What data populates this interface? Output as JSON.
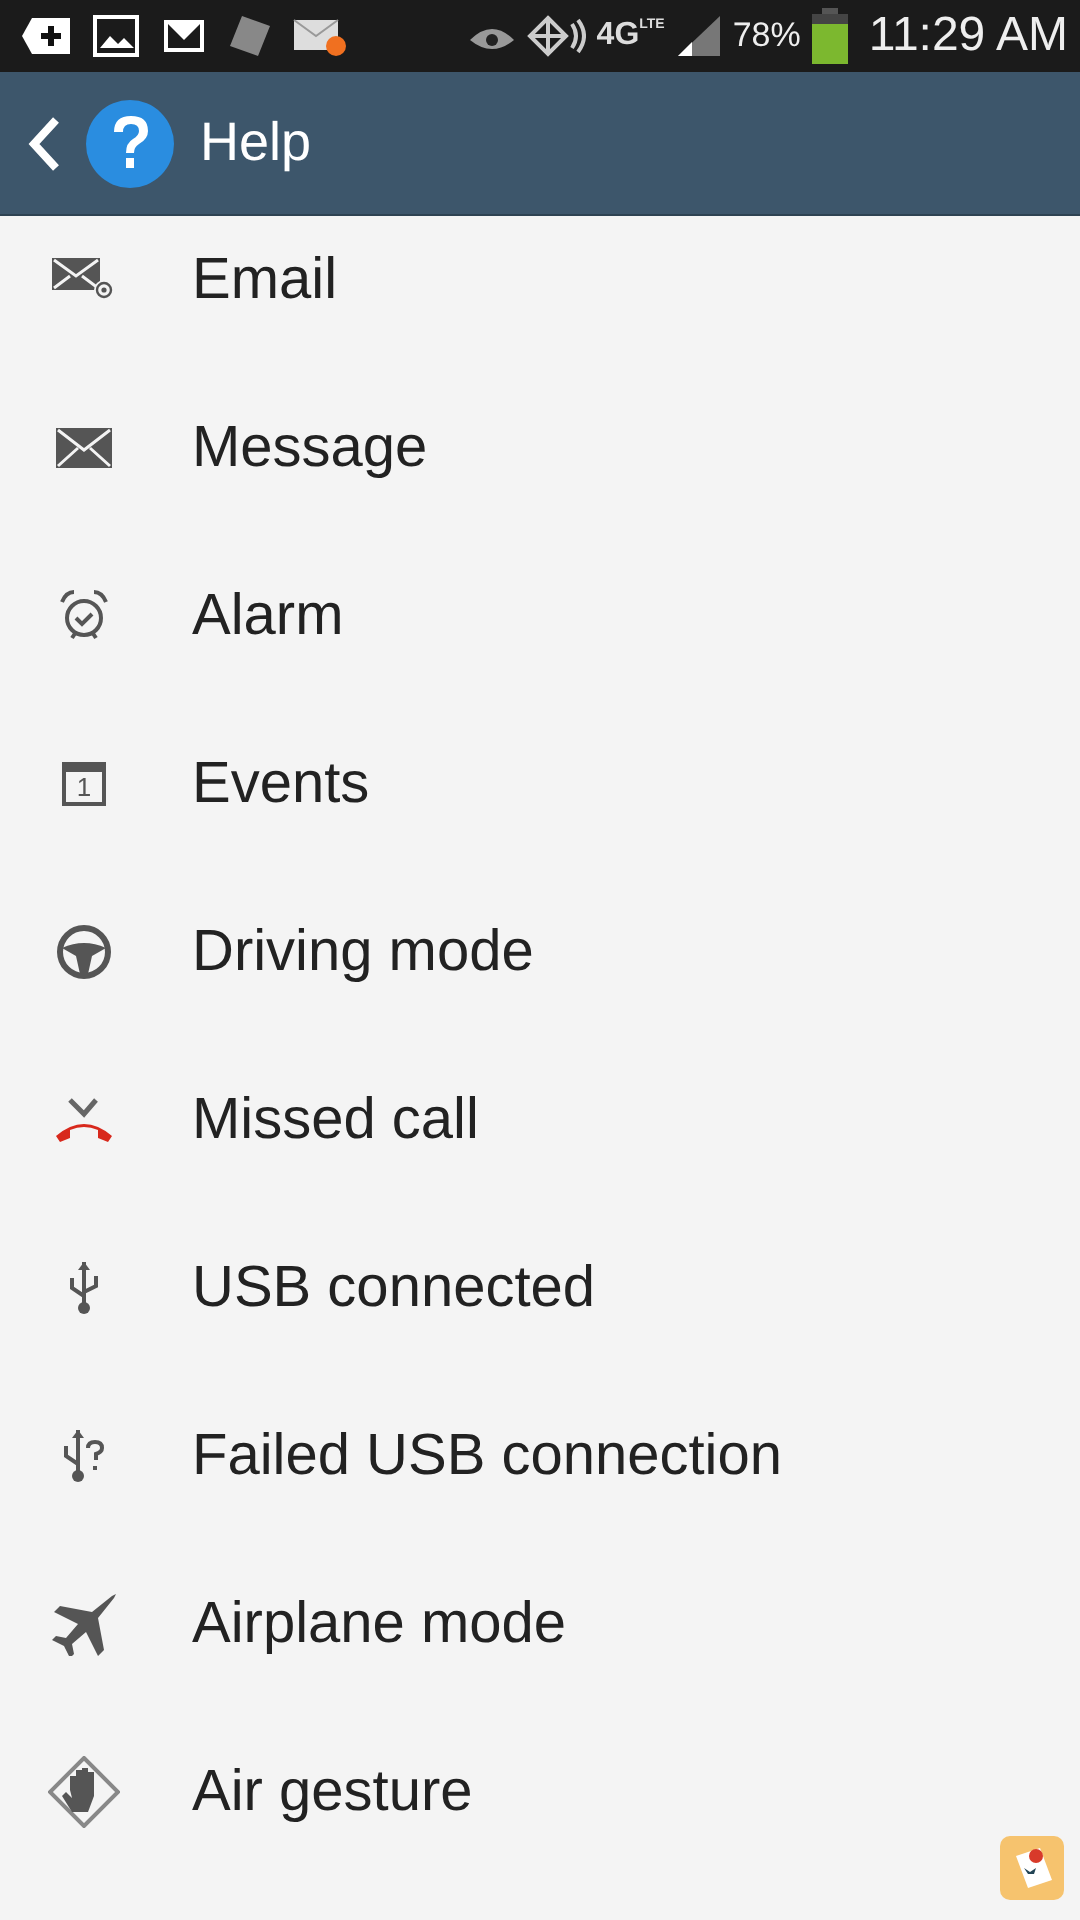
{
  "status_bar": {
    "network": "4G",
    "network_sub": "LTE",
    "battery": "78%",
    "time": "11:29 AM"
  },
  "header": {
    "title": "Help"
  },
  "items": [
    {
      "label": "Email",
      "kind": "email"
    },
    {
      "label": "Message",
      "kind": "message"
    },
    {
      "label": "Alarm",
      "kind": "alarm"
    },
    {
      "label": "Events",
      "kind": "events",
      "icon_text": "1"
    },
    {
      "label": "Driving mode",
      "kind": "driving"
    },
    {
      "label": "Missed call",
      "kind": "missed"
    },
    {
      "label": "USB connected",
      "kind": "usb"
    },
    {
      "label": "Failed USB connection",
      "kind": "usbfail"
    },
    {
      "label": "Airplane mode",
      "kind": "airplane"
    },
    {
      "label": "Air gesture",
      "kind": "gesture"
    }
  ]
}
